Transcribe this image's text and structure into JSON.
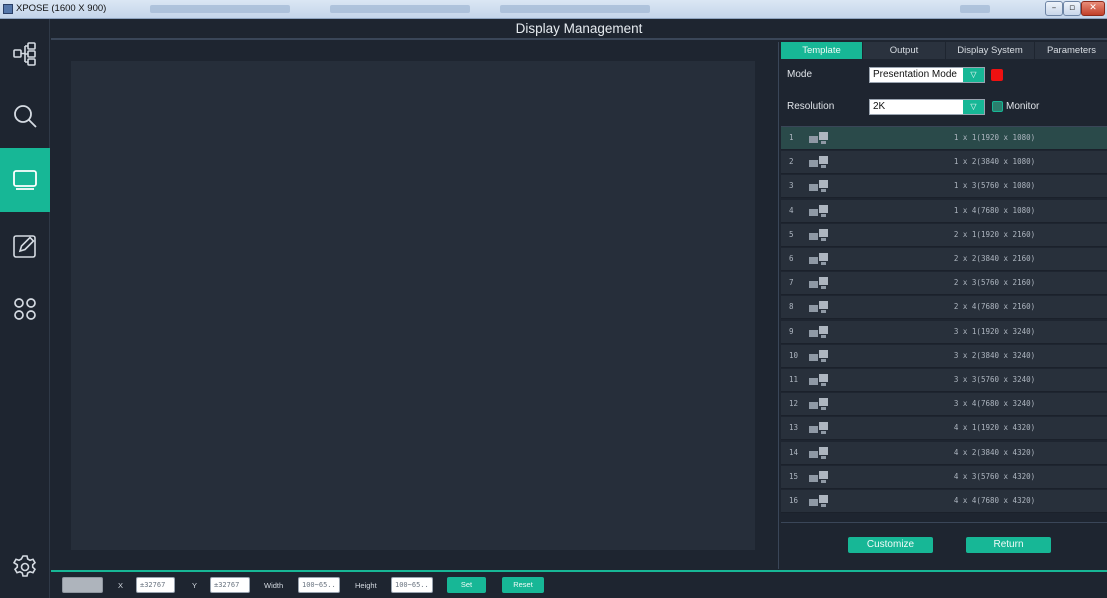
{
  "window": {
    "title": "XPOSE (1600 X 900)"
  },
  "header": {
    "title": "Display Management"
  },
  "sidebar": {
    "items": [
      {
        "icon": "topology-icon",
        "active": false
      },
      {
        "icon": "search-icon",
        "active": false
      },
      {
        "icon": "display-icon",
        "active": true
      },
      {
        "icon": "edit-icon",
        "active": false
      },
      {
        "icon": "apps-grid-icon",
        "active": false
      },
      {
        "icon": "settings-gear-icon",
        "active": false
      }
    ]
  },
  "panel": {
    "tabs": [
      {
        "label": "Template",
        "active": true
      },
      {
        "label": "Output",
        "active": false
      },
      {
        "label": "Display System",
        "active": false
      },
      {
        "label": "Parameters",
        "active": false
      }
    ],
    "mode": {
      "label": "Mode",
      "value": "Presentation Mode",
      "indicator_color": "#ee1111"
    },
    "resolution": {
      "label": "Resolution",
      "value": "2K"
    },
    "monitor": {
      "label": "Monitor",
      "checked": true
    },
    "templates": [
      {
        "num": "1",
        "label": "1 x 1(1920 x 1080)",
        "selected": true
      },
      {
        "num": "2",
        "label": "1 x 2(3840 x 1080)"
      },
      {
        "num": "3",
        "label": "1 x 3(5760 x 1080)"
      },
      {
        "num": "4",
        "label": "1 x 4(7680 x 1080)"
      },
      {
        "num": "5",
        "label": "2 x 1(1920 x 2160)"
      },
      {
        "num": "6",
        "label": "2 x 2(3840 x 2160)"
      },
      {
        "num": "7",
        "label": "2 x 3(5760 x 2160)"
      },
      {
        "num": "8",
        "label": "2 x 4(7680 x 2160)"
      },
      {
        "num": "9",
        "label": "3 x 1(1920 x 3240)"
      },
      {
        "num": "10",
        "label": "3 x 2(3840 x 3240)"
      },
      {
        "num": "11",
        "label": "3 x 3(5760 x 3240)"
      },
      {
        "num": "12",
        "label": "3 x 4(7680 x 3240)"
      },
      {
        "num": "13",
        "label": "4 x 1(1920 x 4320)"
      },
      {
        "num": "14",
        "label": "4 x 2(3840 x 4320)"
      },
      {
        "num": "15",
        "label": "4 x 3(5760 x 4320)"
      },
      {
        "num": "16",
        "label": "4 x 4(7680 x 4320)"
      }
    ],
    "customize_label": "Customize",
    "return_label": "Return"
  },
  "bottom": {
    "x_label": "X",
    "x_placeholder": "±32767",
    "y_label": "Y",
    "y_placeholder": "±32767",
    "width_label": "Width",
    "width_placeholder": "100~65..",
    "height_label": "Height",
    "height_placeholder": "100~65..",
    "set_label": "Set",
    "reset_label": "Reset"
  },
  "colors": {
    "accent": "#17b796",
    "background": "#1e2530",
    "canvas": "#262e3a"
  }
}
